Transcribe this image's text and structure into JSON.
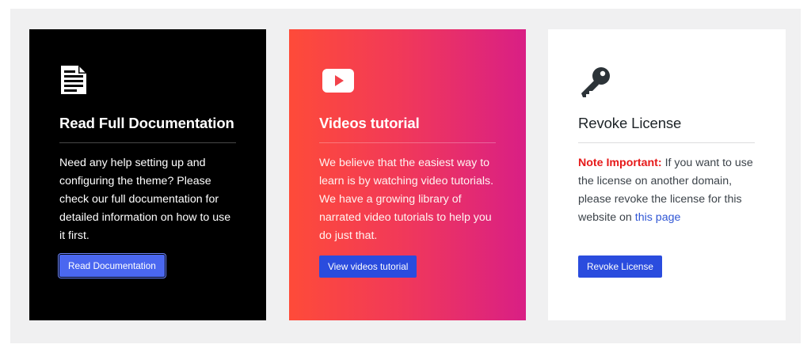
{
  "cards": [
    {
      "icon": "document-icon",
      "title": "Read Full Documentation",
      "description": "Need any help setting up and configuring the theme? Please check our full documentation for detailed information on how to use it first.",
      "button_label": "Read Documentation"
    },
    {
      "icon": "play-video-icon",
      "title": "Videos tutorial",
      "description": "We believe that the easiest way to learn is by watching video tutorials. We have a growing library of narrated video tutorials to help you do just that.",
      "button_label": "View videos tutorial"
    },
    {
      "icon": "key-icon",
      "title": "Revoke License",
      "note_label": "Note Important:",
      "description": " If you want to use the license on another domain, please revoke the license for this website on ",
      "link_text": "this page",
      "button_label": "Revoke License"
    }
  ],
  "colors": {
    "dark_card": "#000000",
    "gradient_start": "#fe4b39",
    "gradient_end": "#d91f85",
    "button": "#2a4cde",
    "note": "#e61a1a",
    "link": "#3157d5"
  }
}
